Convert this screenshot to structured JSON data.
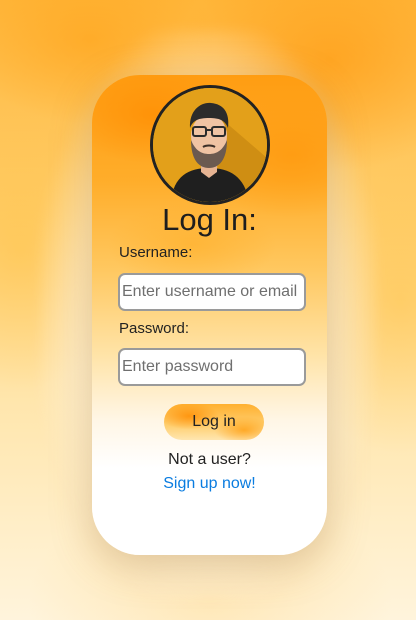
{
  "login": {
    "title": "Log In:",
    "username_label": "Username:",
    "username_placeholder": "Enter username or email",
    "password_label": "Password:",
    "password_placeholder": "Enter password",
    "submit_label": "Log in",
    "not_user_text": "Not a user?",
    "signup_link": "Sign up now!"
  },
  "colors": {
    "accent": "#ff9d12",
    "link": "#0a7ce0",
    "card_bg": "#ffffff"
  },
  "icons": {
    "avatar": "user-avatar-icon"
  }
}
